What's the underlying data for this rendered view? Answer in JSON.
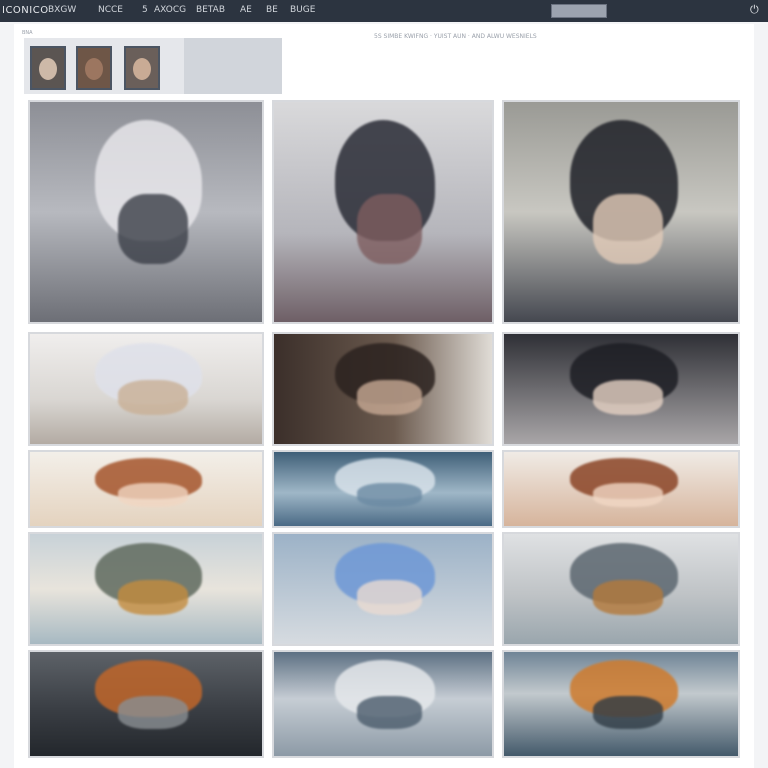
{
  "topbar": {
    "brand": "ICONICO",
    "nav": [
      "BXGW",
      "NCCE",
      "5",
      "AXOCG",
      "BETAB",
      "AE",
      "BE",
      "BUGE"
    ],
    "power_glyph": "⏻"
  },
  "page": {
    "subtitle": "5S SIMBE KWIFNG · YUIST AUN · AND ALWU WESNIELS",
    "mini_label": "BNA"
  },
  "thumbnails": [
    {
      "name": "dark-haired portrait",
      "bg": "#5b5552",
      "face": "#cdb9a8"
    },
    {
      "name": "brown silhouette",
      "bg": "#6e5647",
      "face": "#9c7660"
    },
    {
      "name": "warm portrait",
      "bg": "#6a5f5a",
      "face": "#c9ab95"
    }
  ],
  "tiles": [
    {
      "name": "white-haired-character",
      "bg": "linear-gradient(180deg,#8d8f96 0%,#b7b9bf 50%,#6d6f76 100%)",
      "accent": "#e7e6ea",
      "accent2": "#3b3f48"
    },
    {
      "name": "dark-haired-character-red-coat",
      "bg": "linear-gradient(180deg,#d9d9db 0%,#b5b5bb 60%,#6e5f66 100%)",
      "accent": "#2a2c36",
      "accent2": "#7e5d5f"
    },
    {
      "name": "dark-haired-character-black-coat",
      "bg": "linear-gradient(180deg,#9a9a95 0%,#c8c7c1 50%,#454850 100%)",
      "accent": "#1f2128",
      "accent2": "#e2cbb8"
    },
    {
      "name": "white-haired-closeup",
      "bg": "linear-gradient(180deg,#f0eeed 0%,#d9d6d2 60%,#b3aba3 100%)",
      "accent": "#dfe1ea",
      "accent2": "#c9b096"
    },
    {
      "name": "dark-profile-closeup",
      "bg": "linear-gradient(90deg,#3b2f2a 0%,#6b5a4e 55%,#e0dcd6 100%)",
      "accent": "#2b221f",
      "accent2": "#c7a994"
    },
    {
      "name": "dark-haired-eye-closeup",
      "bg": "linear-gradient(180deg,#2f3036 0%,#a9a6a8 100%)",
      "accent": "#1d1e24",
      "accent2": "#e6d2c4"
    },
    {
      "name": "brown-haired-character",
      "bg": "linear-gradient(180deg,#f3efe9 0%,#e4d3bf 100%)",
      "accent": "#a5552c",
      "accent2": "#f1d6c2"
    },
    {
      "name": "blue-sky-landscape",
      "bg": "linear-gradient(180deg,#3f5f78 0%,#9fb7c7 55%,#4a6a85 100%)",
      "accent": "#d8e2ea",
      "accent2": "#6b8aa3"
    },
    {
      "name": "brown-haired-eyes-closeup",
      "bg": "linear-gradient(180deg,#f0ebe6 0%,#d6b49c 100%)",
      "accent": "#8b4527",
      "accent2": "#f1d7c4"
    },
    {
      "name": "floating-island-ship",
      "bg": "linear-gradient(180deg,#c8d2d8 0%,#e8e4dc 50%,#a7b9c2 100%)",
      "accent": "#5f6a5e",
      "accent2": "#c48c3e"
    },
    {
      "name": "blue-haired-character",
      "bg": "linear-gradient(180deg,#9cb2c7 0%,#d6dbe0 100%)",
      "accent": "#6e98d6",
      "accent2": "#eadbd2"
    },
    {
      "name": "floating-ship-cloudy",
      "bg": "linear-gradient(180deg,#dfe1e3 0%,#bfc3c6 55%,#9aa6ad 100%)",
      "accent": "#5c6770",
      "accent2": "#b4793a"
    },
    {
      "name": "dark-city-orange-shore",
      "bg": "linear-gradient(180deg,#5d6268 0%,#3a3e44 55%,#23272c 100%)",
      "accent": "#c0662a",
      "accent2": "#8a8f93"
    },
    {
      "name": "misty-water-landscape",
      "bg": "linear-gradient(180deg,#5d7083 0%,#c6cdd4 45%,#8d9aa6 100%)",
      "accent": "#e5e8eb",
      "accent2": "#4b5c6c"
    },
    {
      "name": "rocky-coast-sunset",
      "bg": "linear-gradient(180deg,#6f8496 0%,#c2c9cd 40%,#445a6b 100%)",
      "accent": "#cf7b2d",
      "accent2": "#2f3b45"
    }
  ]
}
